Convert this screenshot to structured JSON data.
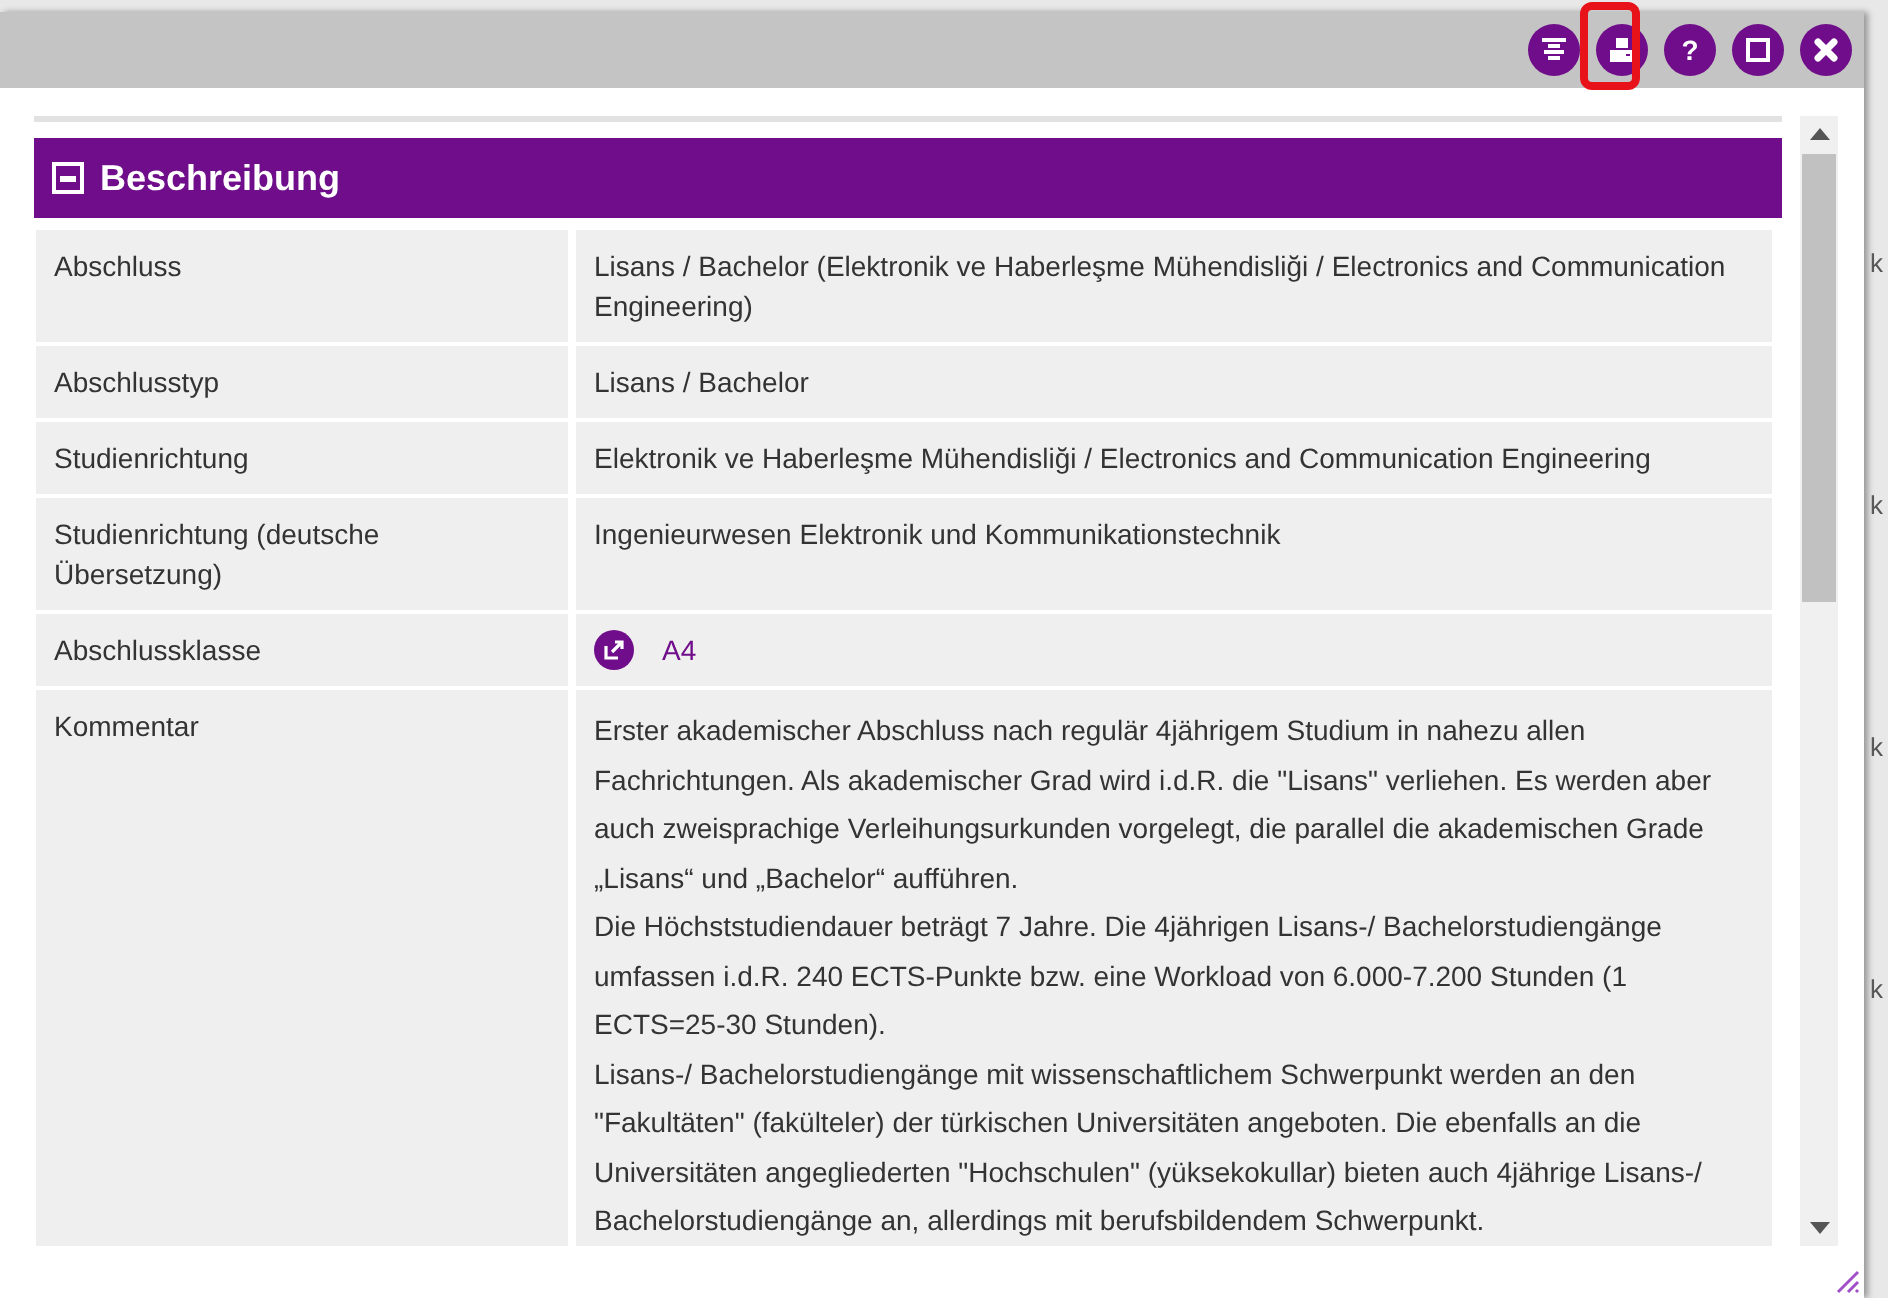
{
  "toolbar": [
    {
      "kind": "layout",
      "annotated": false
    },
    {
      "kind": "print",
      "annotated": true
    },
    {
      "kind": "help",
      "annotated": false,
      "glyph": "?"
    },
    {
      "kind": "maximize",
      "annotated": false
    },
    {
      "kind": "close",
      "annotated": false
    }
  ],
  "section": {
    "title": "Beschreibung",
    "expanded": true,
    "rows": [
      {
        "label": "Abschluss",
        "kind": "text",
        "value": "Lisans / Bachelor (Elektronik ve Haberleşme Mühendisliği / Electronics and Communication Engineering)"
      },
      {
        "label": "Abschlusstyp",
        "kind": "text",
        "value": "Lisans / Bachelor"
      },
      {
        "label": "Studienrichtung",
        "kind": "text",
        "value": "Elektronik ve Haberleşme Mühendisliği / Electronics and Communication Engineering"
      },
      {
        "label": "Studienrichtung (deutsche Übersetzung)",
        "kind": "text",
        "value": "Ingenieurwesen Elektronik und Kommunikationstechnik"
      },
      {
        "label": "Abschlussklasse",
        "kind": "link",
        "value": "A4"
      },
      {
        "label": "Kommentar",
        "kind": "lines",
        "lines": [
          "Erster akademischer Abschluss nach regulär 4jährigem Studium in nahezu allen Fachrichtungen. Als akademischer Grad wird i.d.R. die \"Lisans\" verliehen. Es werden aber auch zweisprachige Verleihungsurkunden vorgelegt, die parallel die akademischen Grade „Lisans“ und „Bachelor“ aufführen.",
          "Die Höchststudiendauer beträgt 7 Jahre. Die 4jährigen Lisans-/ Bachelorstudiengänge umfassen i.d.R. 240 ECTS-Punkte bzw. eine Workload von 6.000-7.200 Stunden (1 ECTS=25-30 Stunden).",
          "Lisans-/ Bachelorstudiengänge mit wissenschaftlichem Schwerpunkt werden an den \"Fakultäten\" (fakülteler) der türkischen Universitäten angeboten. Die ebenfalls an die Universitäten angegliederten \"Hochschulen\" (yüksekokullar) bieten auch 4jährige Lisans-/ Bachelorstudiengänge an, allerdings mit berufsbildendem Schwerpunkt."
        ]
      }
    ]
  },
  "background_texts": [
    "k",
    "k",
    "k",
    "k"
  ]
}
